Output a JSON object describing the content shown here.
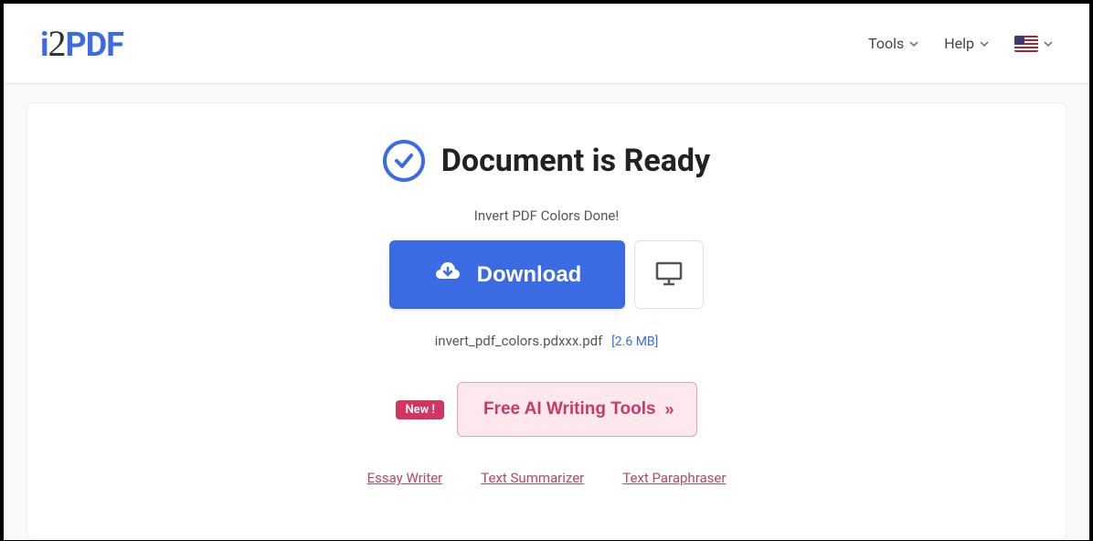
{
  "header": {
    "logo": {
      "i": "i",
      "two": "2",
      "pdf": "PDF"
    },
    "nav": {
      "tools": "Tools",
      "help": "Help"
    }
  },
  "main": {
    "title": "Document is Ready",
    "subtitle": "Invert PDF Colors Done!",
    "download_label": "Download",
    "file_name": "invert_pdf_colors.pdxxx.pdf",
    "file_size": "[2.6 MB]",
    "new_badge": "New !",
    "ai_button": "Free AI Writing Tools",
    "links": {
      "essay": "Essay Writer",
      "summarizer": "Text Summarizer",
      "paraphraser": "Text Paraphraser"
    }
  }
}
